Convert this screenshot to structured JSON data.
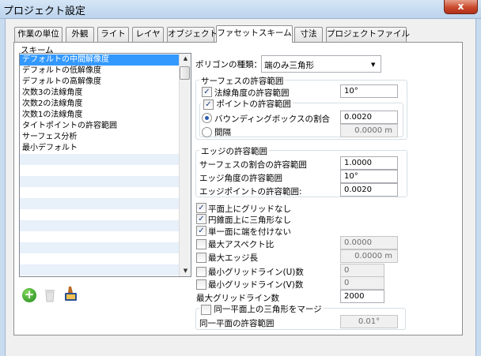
{
  "window": {
    "title": "プロジェクト設定",
    "close_glyph": "x"
  },
  "tabs": [
    {
      "label": "作業の単位"
    },
    {
      "label": "外観"
    },
    {
      "label": "ライト"
    },
    {
      "label": "レイヤ"
    },
    {
      "label": "オブジェクト"
    },
    {
      "label": "ファセットスキーム",
      "active": true
    },
    {
      "label": "寸法"
    },
    {
      "label": "プロジェクトファイル"
    }
  ],
  "scheme": {
    "label": "スキーム",
    "items": [
      {
        "label": "デフォルトの中間解像度",
        "selected": true
      },
      {
        "label": "デフォルトの低解像度"
      },
      {
        "label": "デフォルトの高解像度"
      },
      {
        "label": "次数3の法線角度"
      },
      {
        "label": "次数2の法線角度"
      },
      {
        "label": "次数1の法線角度"
      },
      {
        "label": "タイトポイントの許容範囲"
      },
      {
        "label": "サーフェス分析"
      },
      {
        "label": "最小デフォルト"
      }
    ],
    "scroll_up": "▲",
    "scroll_down": "▼"
  },
  "icons": {
    "add": "add-icon",
    "delete": "trash-icon",
    "edit": "edit-icon",
    "add_glyph": "+"
  },
  "polygon_type": {
    "label": "ポリゴンの種類：",
    "value": "端のみ三角形",
    "arrow": "▼"
  },
  "surface_tolerance": {
    "title": "サーフェスの許容範囲",
    "normal_angle": {
      "label": "法線角度の許容範囲",
      "checked": true,
      "value": "10°"
    },
    "point_tolerance": {
      "label": "ポイントの許容範囲",
      "checked": true
    },
    "bounding_box": {
      "label": "バウンディングボックスの割合",
      "selected": true,
      "value": "0.0020"
    },
    "interval": {
      "label": "間隔",
      "selected": false,
      "value": "0.0000 m"
    }
  },
  "edge_tolerance": {
    "title": "エッジの許容範囲",
    "surface_ratio": {
      "label": "サーフェスの割合の許容範囲",
      "value": "1.0000"
    },
    "edge_angle": {
      "label": "エッジ角度の許容範囲",
      "value": "10°"
    },
    "edge_point": {
      "label": "エッジポイントの許容範囲:",
      "value": "0.0020"
    }
  },
  "options": {
    "no_grid_plane": {
      "label": "平面上にグリッドなし",
      "checked": true
    },
    "cone_triangle": {
      "label": "円錐面上に三角形なし",
      "checked": true
    },
    "no_edge_single": {
      "label": "単一面に端を付けない",
      "checked": true
    },
    "max_aspect": {
      "label": "最大アスペクト比",
      "checked": false,
      "value": "0.0000"
    },
    "max_edge": {
      "label": "最大エッジ長",
      "checked": false,
      "value": "0.0000 m"
    },
    "min_grid_u": {
      "label": "最小グリッドライン(U)数",
      "checked": false,
      "value": "0"
    },
    "min_grid_v": {
      "label": "最小グリッドライン(V)数",
      "checked": false,
      "value": "0"
    },
    "max_grid": {
      "label": "最大グリッドライン数",
      "value": "2000"
    }
  },
  "merge": {
    "label": "同一平面上の三角形をマージ",
    "checked": false,
    "tolerance_label": "同一平面の許容範囲",
    "tolerance_value": "0.01°"
  },
  "check_glyph": "✓"
}
